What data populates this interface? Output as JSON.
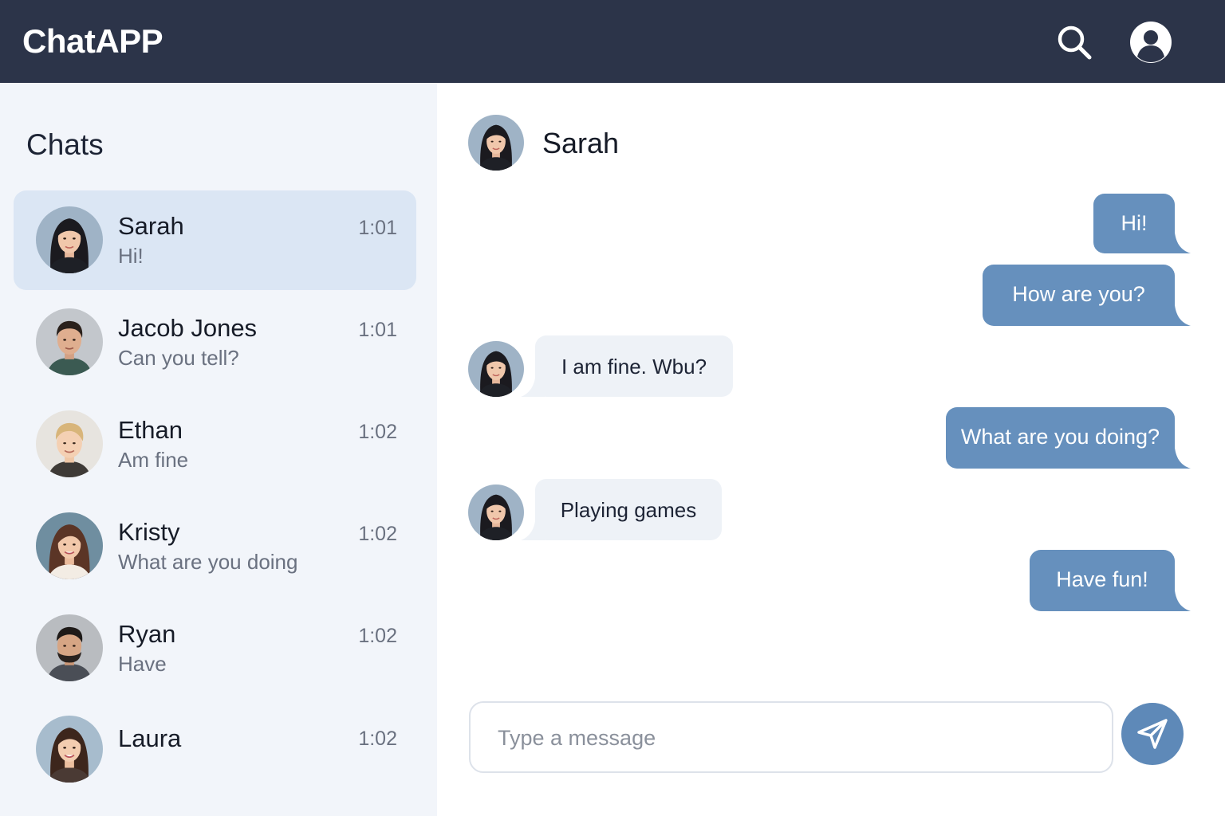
{
  "app": {
    "title": "ChatAPP"
  },
  "header": {
    "search_icon": "search-icon",
    "profile_icon": "user-profile-icon"
  },
  "sidebar": {
    "title": "Chats",
    "items": [
      {
        "name": "Sarah",
        "preview": "Hi!",
        "time": "1:01",
        "active": true
      },
      {
        "name": "Jacob Jones",
        "preview": "Can you tell?",
        "time": "1:01",
        "active": false
      },
      {
        "name": "Ethan",
        "preview": "Am fine",
        "time": "1:02",
        "active": false
      },
      {
        "name": "Kristy",
        "preview": "What are you doing",
        "time": "1:02",
        "active": false
      },
      {
        "name": "Ryan",
        "preview": "Have",
        "time": "1:02",
        "active": false
      },
      {
        "name": "Laura",
        "preview": "",
        "time": "1:02",
        "active": false
      }
    ]
  },
  "conversation": {
    "contact_name": "Sarah",
    "messages": [
      {
        "direction": "out",
        "text": "Hi!"
      },
      {
        "direction": "out",
        "text": "How are you?"
      },
      {
        "direction": "in",
        "text": "I am fine. Wbu?"
      },
      {
        "direction": "out",
        "text": "What are you doing?"
      },
      {
        "direction": "in",
        "text": "Playing games"
      },
      {
        "direction": "out",
        "text": "Have fun!"
      }
    ]
  },
  "composer": {
    "placeholder": "Type a message",
    "value": "",
    "send_icon": "send-icon"
  },
  "colors": {
    "header_bg": "#2c3449",
    "sidebar_bg": "#f2f5fa",
    "active_item_bg": "#dbe6f4",
    "outgoing_bubble": "#6690bd",
    "incoming_bubble": "#eef2f7",
    "send_button": "#5e89b8"
  }
}
